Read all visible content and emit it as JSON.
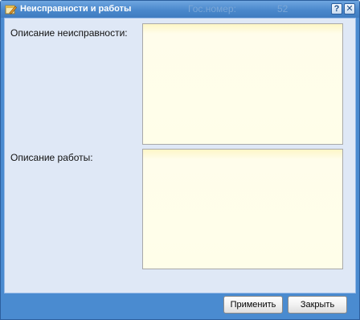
{
  "window": {
    "title": "Неисправности и работы",
    "background_text_1": "Гос.номер:",
    "background_text_2": "52",
    "help_glyph": "?",
    "close_glyph": "✕",
    "title_icon": "edit-window-icon"
  },
  "form": {
    "fault_label": "Описание неисправности:",
    "fault_value": "",
    "work_label": "Описание работы:",
    "work_value": ""
  },
  "footer": {
    "apply_label": "Применить",
    "close_label": "Закрыть"
  },
  "colors": {
    "window_frame": "#4a8bd0",
    "body_bg": "#dfe8f6",
    "field_bg": "#fffee9"
  }
}
